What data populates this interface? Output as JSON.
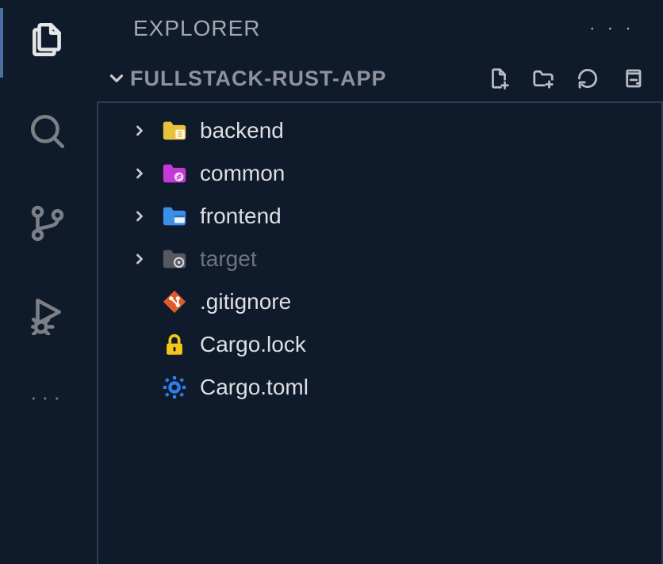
{
  "sidebar": {
    "title": "EXPLORER",
    "section": "FULLSTACK-RUST-APP"
  },
  "tree": {
    "items": [
      {
        "label": "backend",
        "type": "folder",
        "dim": false
      },
      {
        "label": "common",
        "type": "folder",
        "dim": false
      },
      {
        "label": "frontend",
        "type": "folder",
        "dim": false
      },
      {
        "label": "target",
        "type": "folder",
        "dim": true
      },
      {
        "label": ".gitignore",
        "type": "file",
        "dim": false
      },
      {
        "label": "Cargo.lock",
        "type": "file",
        "dim": false
      },
      {
        "label": "Cargo.toml",
        "type": "file",
        "dim": false
      }
    ]
  }
}
